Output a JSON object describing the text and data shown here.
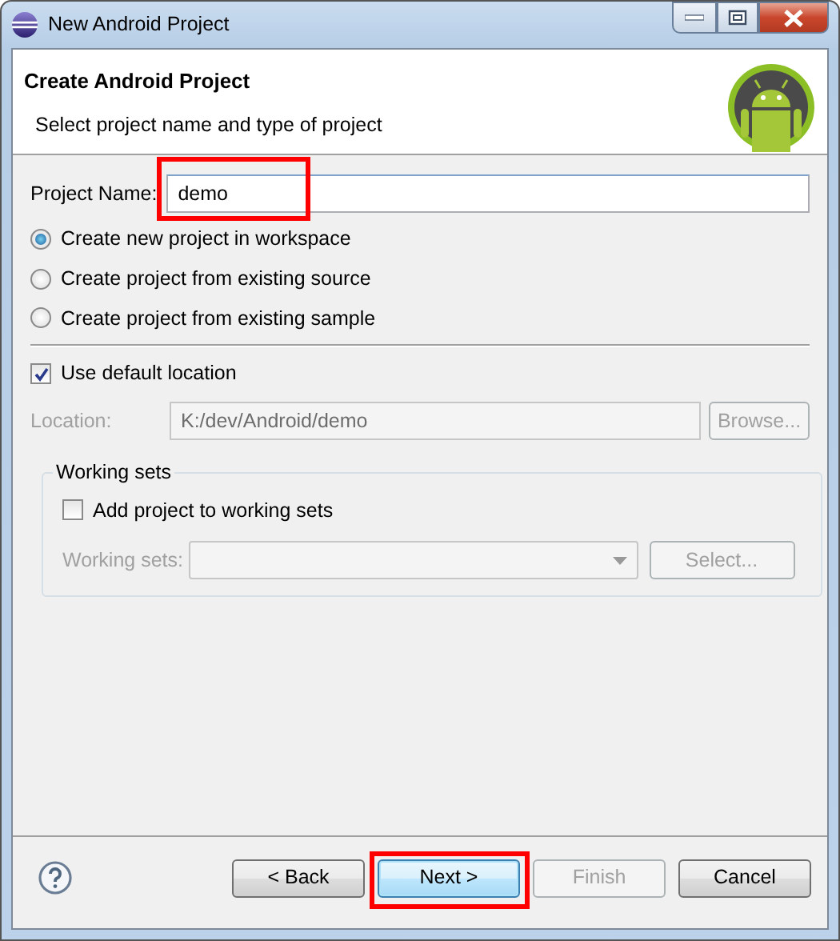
{
  "window": {
    "title": "New Android Project"
  },
  "header": {
    "title": "Create Android Project",
    "subtitle": "Select project name and type of project"
  },
  "project_name": {
    "label": "Project Name:",
    "value": "demo",
    "highlighted": true
  },
  "project_types": [
    {
      "label": "Create new project in workspace",
      "selected": true
    },
    {
      "label": "Create project from existing source",
      "selected": false
    },
    {
      "label": "Create project from existing sample",
      "selected": false
    }
  ],
  "use_default_location": {
    "label": "Use default location",
    "checked": true
  },
  "location": {
    "label": "Location:",
    "value": "K:/dev/Android/demo",
    "disabled": true,
    "browse_button": "Browse..."
  },
  "working_sets": {
    "title": "Working sets",
    "add_checkbox": {
      "label": "Add project to working sets",
      "checked": false
    },
    "field_label": "Working sets:",
    "select_button": "Select...",
    "disabled": true
  },
  "buttons": [
    {
      "label": "< Back",
      "disabled": false,
      "default": false,
      "highlighted": false
    },
    {
      "label": "Next >",
      "disabled": false,
      "default": true,
      "highlighted": true
    },
    {
      "label": "Finish",
      "disabled": true,
      "default": false,
      "highlighted": false
    },
    {
      "label": "Cancel",
      "disabled": false,
      "default": false,
      "highlighted": false
    }
  ]
}
